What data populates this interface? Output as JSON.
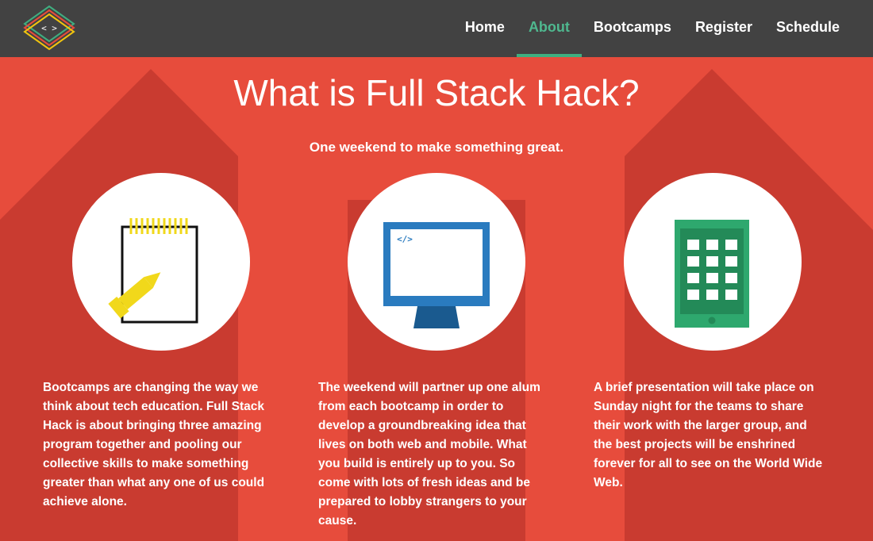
{
  "nav": {
    "logo_icon": "diamond-code-logo",
    "items": [
      {
        "label": "Home",
        "active": false
      },
      {
        "label": "About",
        "active": true
      },
      {
        "label": "Bootcamps",
        "active": false
      },
      {
        "label": "Register",
        "active": false
      },
      {
        "label": "Schedule",
        "active": false
      }
    ]
  },
  "hero": {
    "title": "What is Full Stack Hack?",
    "subtitle": "One weekend to make something great."
  },
  "features": [
    {
      "icon": "notepad-pencil-icon",
      "text": "Bootcamps are changing the way we think about tech education. Full Stack Hack is about bringing three amazing program together and pooling our collective skills to make something greater than what any one of us could achieve alone."
    },
    {
      "icon": "desktop-monitor-icon",
      "text": "The weekend will partner up one alum from each bootcamp in order to develop a groundbreaking idea that lives on both web and mobile. What you build is entirely up to you. So come with lots of fresh ideas and be prepared to lobby strangers to your cause."
    },
    {
      "icon": "tablet-icon",
      "text": "A brief presentation will take place on Sunday night for the teams to share their work with the larger group, and the best projects will be enshrined forever for all to see on the World Wide Web."
    }
  ],
  "colors": {
    "background": "#e74c3c",
    "navbar": "#424242",
    "nav_active": "#4fb88f",
    "shadow": "#c93b30"
  }
}
